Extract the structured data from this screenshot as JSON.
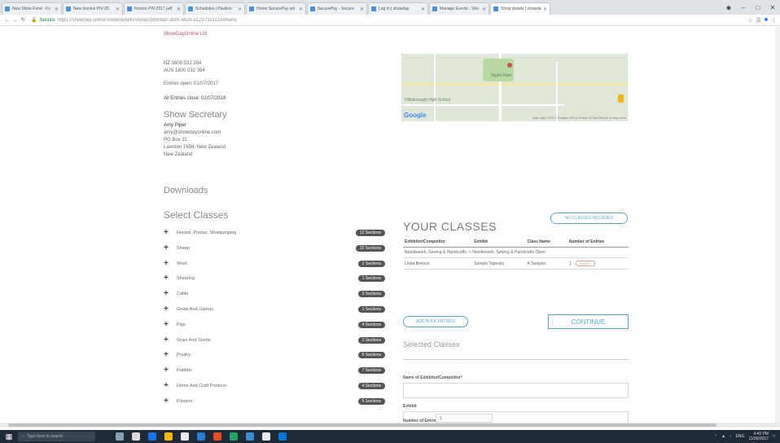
{
  "browser": {
    "tabs": [
      {
        "label": "New Show Food - Fo",
        "active": false
      },
      {
        "label": "New Invoice PIV-20",
        "active": false
      },
      {
        "label": "Invoice PIV-2017.pdf",
        "active": false
      },
      {
        "label": "Schedules | Pavilion",
        "active": false
      },
      {
        "label": "Home SecurePay onl",
        "active": false
      },
      {
        "label": "SecurePay - Secure",
        "active": false
      },
      {
        "label": "Log in | showday",
        "active": false
      },
      {
        "label": "Manage Events - Sho",
        "active": false
      },
      {
        "label": "Show details | showday",
        "active": true
      }
    ],
    "secure_label": "Secure",
    "url": "https://showday.online/show/details/show/2b6f0da0-d5f6-4829-a129-f1c1c150ba0d"
  },
  "show_info": {
    "organiser_link": "ShowDayOnline Ltd",
    "phone_nz": "NZ  0800 032 394",
    "phone_aus": "AUS 1800 032 394",
    "entries_open": "Entries open: 01/07/2017",
    "entries_close": "All Entries close: 01/07/2018"
  },
  "secretary": {
    "heading": "Show Secretary",
    "name": "Amy Piper",
    "email": "amy@showdayonline.com",
    "address1": "PO Box 11",
    "address2": "Lawston 7656, New Zealand",
    "address3": "New Zealand"
  },
  "map": {
    "labels": [
      "Taylor Park",
      "Hillsborough High School"
    ],
    "copyright": "Map data ©2017 Google  200 m  Terms of Use  Report a map error",
    "google": "Google"
  },
  "downloads": {
    "heading": "Downloads"
  },
  "select_classes": {
    "heading": "Select Classes",
    "items": [
      {
        "name": "Horses, Ponies, Showjumping",
        "badge": "12 Sections"
      },
      {
        "name": "Sheep",
        "badge": "22 Sections"
      },
      {
        "name": "Wool",
        "badge": "2 Sections"
      },
      {
        "name": "Shearing",
        "badge": "1 Sections"
      },
      {
        "name": "Cattle",
        "badge": "3 Sections"
      },
      {
        "name": "Goats And Llamas",
        "badge": "1 Sections"
      },
      {
        "name": "Pigs",
        "badge": "4 Sections"
      },
      {
        "name": "Grain And Seeds",
        "badge": "2 Sections"
      },
      {
        "name": "Poultry",
        "badge": "6 Sections"
      },
      {
        "name": "Rabbits",
        "badge": "7 Sections"
      },
      {
        "name": "Home And Craft Produce",
        "badge": "4 Sections"
      },
      {
        "name": "Flowers",
        "badge": "5 Sections"
      }
    ]
  },
  "your_classes": {
    "title": "YOUR CLASSES",
    "no_classes_button": "NO CLASSES INCLUDED",
    "columns": [
      "Exhibitor/Competitor",
      "Exhibit",
      "Class Name",
      "Number of Entries"
    ],
    "section_row": "Needlework, Sewing & Handcrafts -> Needlework, Sewing & Handcrafts Open",
    "rows": [
      {
        "exhibitor": "Linda Benson",
        "exhibit": "Sample Tapestry",
        "class_name": "A Sampler",
        "entries": "1",
        "action": "remove"
      }
    ],
    "add_bulk_button": "ADD BULK ENTRIES",
    "continue_button": "CONTINUE"
  },
  "selected_classes": {
    "heading": "Selected Classes",
    "name_label": "Name of Exhibitor/Competitor",
    "required_mark": "*",
    "exhibit_label": "Exhibit",
    "number_label": "Number of Entries",
    "number_value": "1"
  },
  "taskbar": {
    "search_placeholder": "Type here to search",
    "tray_lang": "ENG",
    "time": "4:43 PM",
    "date": "11/09/2017",
    "icon_colors": [
      "#8aa0b4",
      "#d9d9d9",
      "#1a73e8",
      "#ffb900",
      "#e8eaed",
      "#2b7cd3",
      "#e34c26",
      "#1fa463",
      "#3c8ed4",
      "#e8eaed",
      "#0078d7"
    ]
  },
  "colors": {
    "accent": "#5aa5d6",
    "brand": "#b54a7c",
    "badge": "#555555",
    "required": "#d24a43"
  }
}
